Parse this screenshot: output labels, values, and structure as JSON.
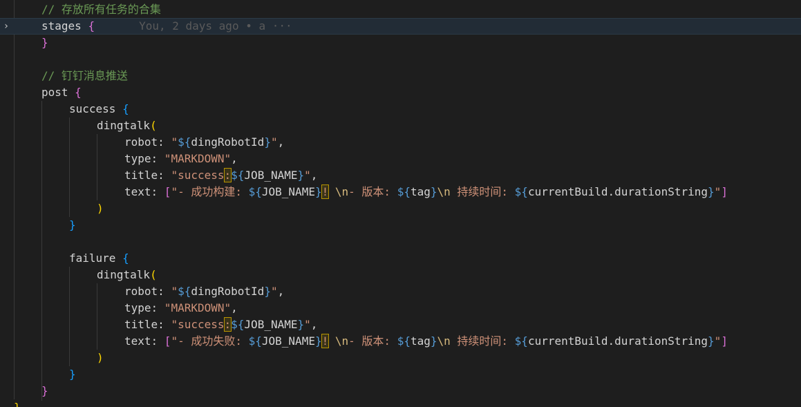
{
  "editor": {
    "lines": {
      "comment_stages": "// 存放所有任务的合集",
      "stages": "stages",
      "blame": "You, 2 days ago • a ···",
      "comment_post": "// 钉钉消息推送",
      "post": "post",
      "success": "success",
      "failure": "failure",
      "dingtalk": "dingtalk",
      "robot_key": "robot",
      "robot_val": "dingRobotId",
      "type_key": "type",
      "type_val": "MARKDOWN",
      "title_key": "title",
      "title_prefix": "success",
      "job_name": "JOB_NAME",
      "text_key": "text",
      "success_text_a": "- 成功构建: ",
      "failure_text_a": "- 成功失败: ",
      "newline_esc": "\\n",
      "version_label": "- 版本: ",
      "tag_var": "tag",
      "duration_label": " 持续时间: ",
      "duration_var": "currentBuild.durationString"
    },
    "fold_icon": "chevron-right-icon",
    "colors": {
      "background": "#1e1e1e",
      "comment": "#6a9955",
      "string": "#ce9178",
      "template": "#569cd6",
      "bracket_level1": "#da70d6",
      "bracket_level2": "#179fff",
      "bracket_level3": "#ffd700",
      "warning_outline": "#b89500"
    }
  }
}
